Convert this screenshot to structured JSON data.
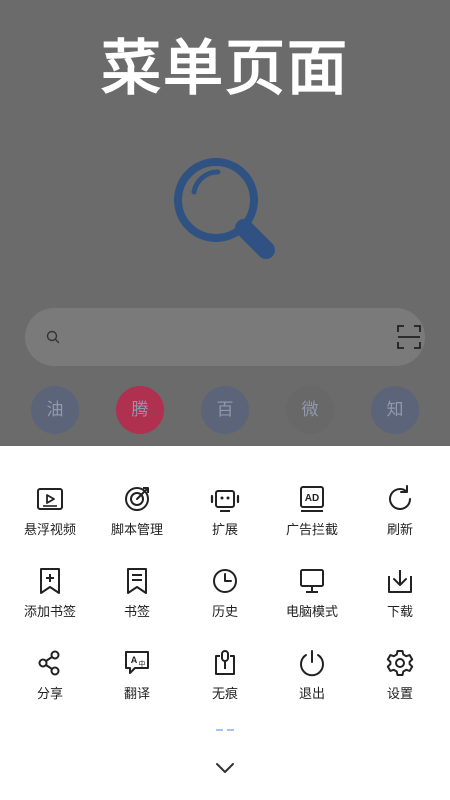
{
  "header": {
    "title": "菜单页面"
  },
  "search": {
    "placeholder": ""
  },
  "quick_links": [
    {
      "label": "油",
      "color": "#5b6478"
    },
    {
      "label": "腾",
      "color": "#b03050"
    },
    {
      "label": "百",
      "color": "#5b6478"
    },
    {
      "label": "微",
      "color": "#686868"
    },
    {
      "label": "知",
      "color": "#5b6478"
    }
  ],
  "menu": {
    "items": [
      {
        "label": "悬浮视频",
        "icon": "video-icon"
      },
      {
        "label": "脚本管理",
        "icon": "script-icon"
      },
      {
        "label": "扩展",
        "icon": "extension-icon"
      },
      {
        "label": "广告拦截",
        "icon": "ad-block-icon"
      },
      {
        "label": "刷新",
        "icon": "refresh-icon"
      },
      {
        "label": "添加书签",
        "icon": "add-bookmark-icon"
      },
      {
        "label": "书签",
        "icon": "bookmark-icon"
      },
      {
        "label": "历史",
        "icon": "history-icon"
      },
      {
        "label": "电脑模式",
        "icon": "desktop-icon"
      },
      {
        "label": "下载",
        "icon": "download-icon"
      },
      {
        "label": "分享",
        "icon": "share-icon"
      },
      {
        "label": "翻译",
        "icon": "translate-icon"
      },
      {
        "label": "无痕",
        "icon": "incognito-icon"
      },
      {
        "label": "退出",
        "icon": "power-icon"
      },
      {
        "label": "设置",
        "icon": "settings-icon"
      }
    ]
  },
  "colors": {
    "overlay": "#6b6b6b",
    "sheet": "#ffffff",
    "logo": "#2f5283",
    "pager": "#a8c4e8"
  }
}
